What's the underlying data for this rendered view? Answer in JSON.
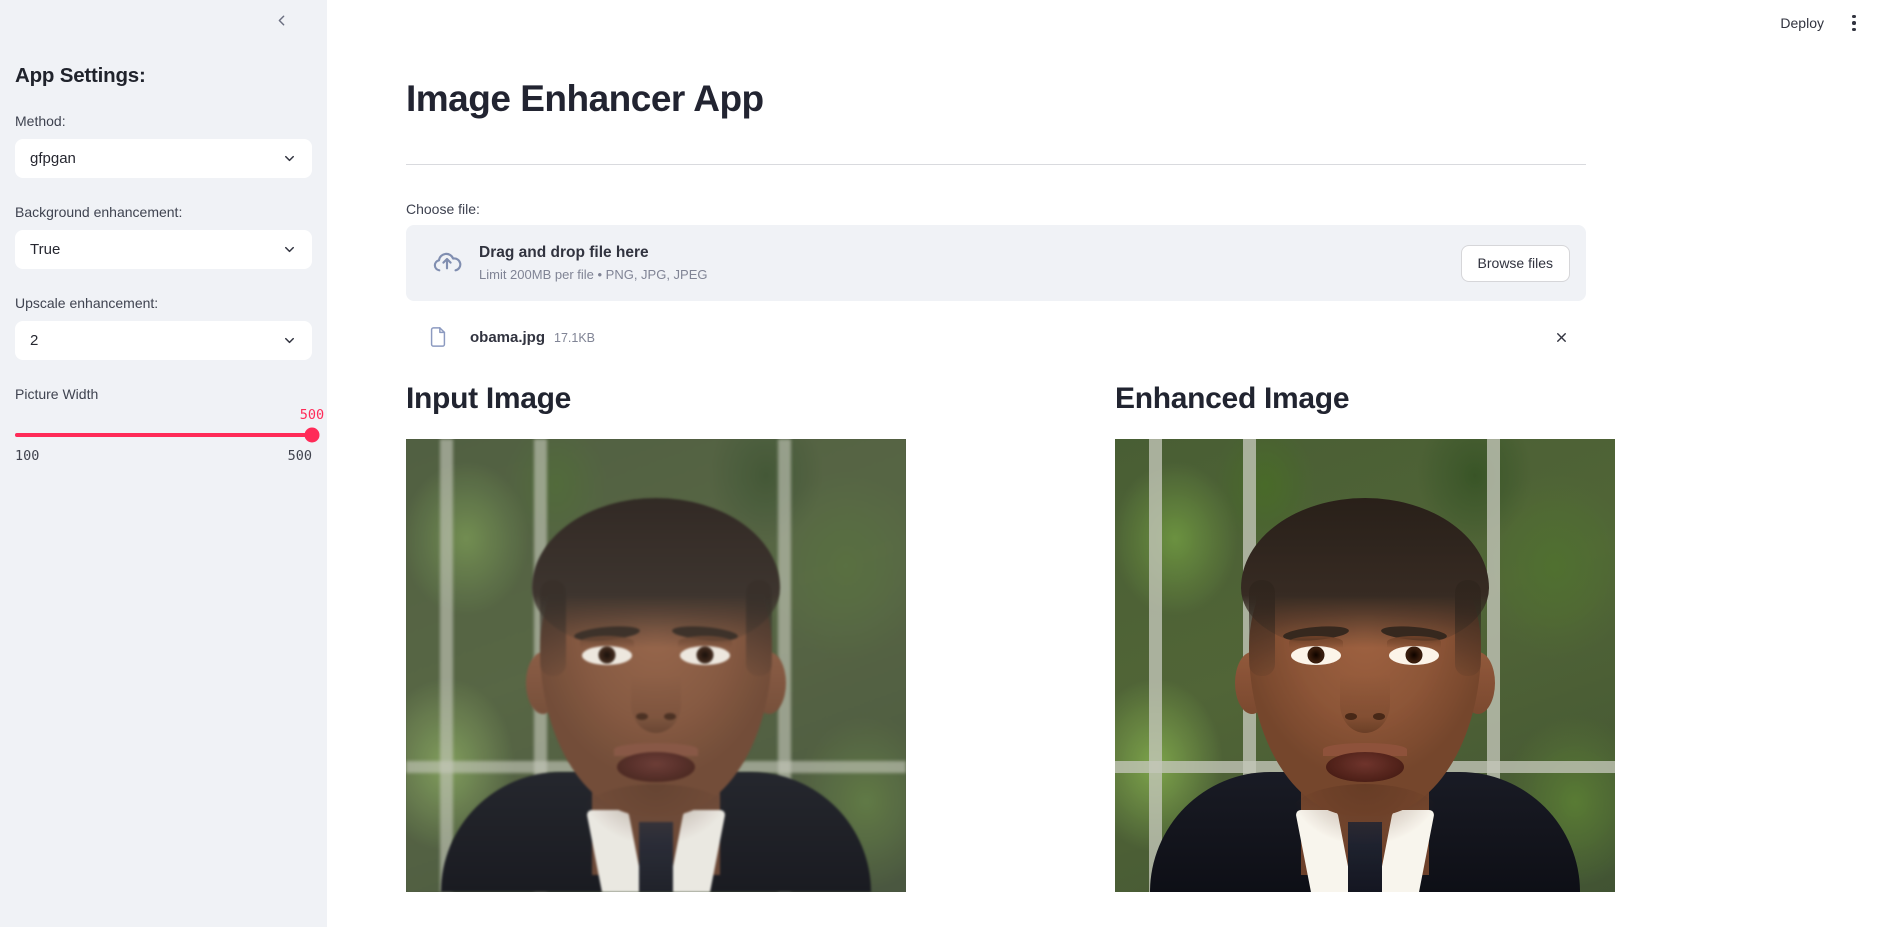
{
  "sidebar": {
    "collapse_icon": "chevron-left-icon",
    "heading": "App Settings:",
    "fields": [
      {
        "label": "Method:",
        "value": "gfpgan",
        "caret_icon": "chevron-down-icon"
      },
      {
        "label": "Background enhancement:",
        "value": "True",
        "caret_icon": "chevron-down-icon"
      },
      {
        "label": "Upscale enhancement:",
        "value": "2",
        "caret_icon": "chevron-down-icon"
      }
    ],
    "slider": {
      "label": "Picture Width",
      "value": "500",
      "min": "100",
      "max": "500",
      "value_num": 500,
      "min_num": 100,
      "max_num": 500,
      "accent_color": "#ff2b58",
      "track_color": "#d5d8e0"
    },
    "background_color": "#f0f2f6"
  },
  "topbar": {
    "deploy_label": "Deploy",
    "menu_icon": "kebab-menu-icon"
  },
  "main": {
    "title": "Image Enhancer App",
    "choose_file_label": "Choose file:",
    "uploader": {
      "cloud_icon": "cloud-upload-icon",
      "drag_text": "Drag and drop file here",
      "limit_text": "Limit 200MB per file • PNG, JPG, JPEG",
      "browse_label": "Browse files"
    },
    "uploaded_file": {
      "file_icon": "file-document-icon",
      "name": "obama.jpg",
      "size": "17.1KB",
      "remove_icon": "close-x-icon"
    },
    "columns": [
      {
        "title": "Input Image",
        "image_alt": "portrait photo of a man in a dark suit in front of a window with green foliage",
        "variant": "soft"
      },
      {
        "title": "Enhanced Image",
        "image_alt": "enhanced sharper portrait photo of a man in a dark suit in front of a window with green foliage",
        "variant": "sharp"
      }
    ]
  }
}
